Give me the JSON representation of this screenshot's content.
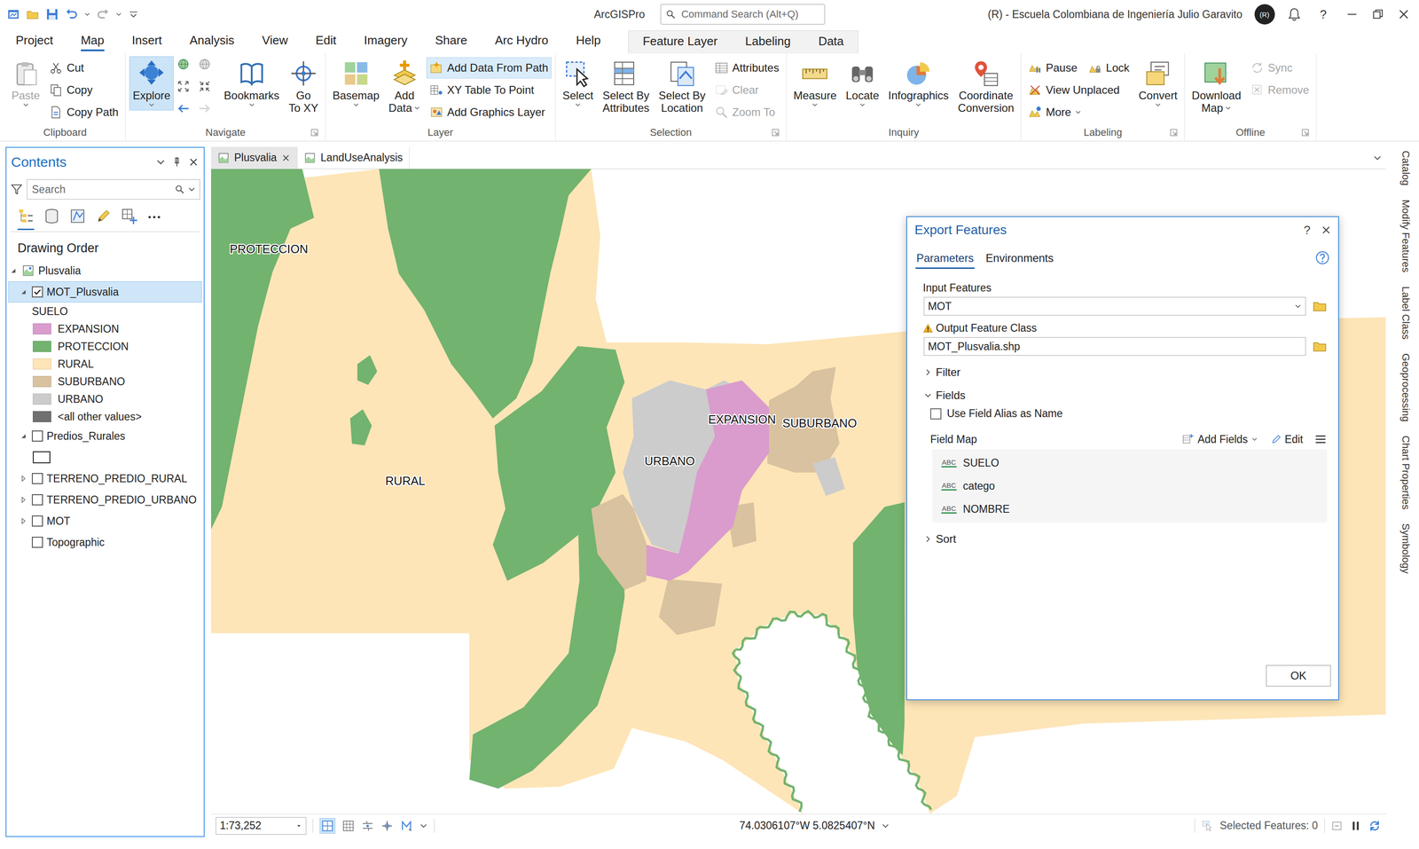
{
  "window": {
    "app_title": "ArcGISPro",
    "command_search": {
      "placeholder": "Command Search (Alt+Q)"
    },
    "account": "(R) - Escuela Colombiana de Ingeniería Julio Garavito",
    "avatar": "(R)",
    "help": "?"
  },
  "ribbon_tabs": [
    {
      "label": "Project",
      "selected": false,
      "contextual": false
    },
    {
      "label": "Map",
      "selected": true,
      "contextual": false
    },
    {
      "label": "Insert",
      "selected": false,
      "contextual": false
    },
    {
      "label": "Analysis",
      "selected": false,
      "contextual": false
    },
    {
      "label": "View",
      "selected": false,
      "contextual": false
    },
    {
      "label": "Edit",
      "selected": false,
      "contextual": false
    },
    {
      "label": "Imagery",
      "selected": false,
      "contextual": false
    },
    {
      "label": "Share",
      "selected": false,
      "contextual": false
    },
    {
      "label": "Arc Hydro",
      "selected": false,
      "contextual": false
    },
    {
      "label": "Help",
      "selected": false,
      "contextual": false
    },
    {
      "label": "Feature Layer",
      "selected": false,
      "contextual": true
    },
    {
      "label": "Labeling",
      "selected": false,
      "contextual": true
    },
    {
      "label": "Data",
      "selected": false,
      "contextual": true
    }
  ],
  "ribbon_groups": [
    {
      "label": "Clipboard",
      "launcher": false,
      "columns": [
        {
          "kind": "large",
          "lines": [
            "Paste"
          ],
          "dropdown": true,
          "disabled": true,
          "highlighted": false
        },
        {
          "kind": "small",
          "rows": [
            [
              {
                "label": "Cut",
                "dropdown": false,
                "disabled": false,
                "highlighted": false
              }
            ],
            [
              {
                "label": "Copy",
                "dropdown": false,
                "disabled": false,
                "highlighted": false
              }
            ],
            [
              {
                "label": "Copy Path",
                "dropdown": false,
                "disabled": false,
                "highlighted": false
              }
            ]
          ]
        }
      ]
    },
    {
      "label": "Navigate",
      "launcher": true,
      "columns": [
        {
          "kind": "large",
          "lines": [
            "Explore"
          ],
          "dropdown": true,
          "disabled": false,
          "highlighted": true
        },
        {
          "kind": "icons",
          "items": [
            {
              "disabled": false
            },
            {
              "disabled": false
            },
            {
              "disabled": false
            },
            {
              "disabled": false
            },
            {
              "disabled": false
            },
            {
              "disabled": true
            }
          ]
        },
        {
          "kind": "large",
          "lines": [
            "Bookmarks"
          ],
          "dropdown": true,
          "disabled": false,
          "highlighted": false
        },
        {
          "kind": "large",
          "lines": [
            "Go",
            "To XY"
          ],
          "dropdown": false,
          "disabled": false,
          "highlighted": false
        }
      ]
    },
    {
      "label": "Layer",
      "launcher": false,
      "columns": [
        {
          "kind": "large",
          "lines": [
            "Basemap"
          ],
          "dropdown": true,
          "disabled": false,
          "highlighted": false
        },
        {
          "kind": "large",
          "lines": [
            "Add",
            "Data"
          ],
          "dropdown": true,
          "disabled": false,
          "highlighted": false
        },
        {
          "kind": "small",
          "rows": [
            [
              {
                "label": "Add Data From Path",
                "dropdown": false,
                "disabled": false,
                "highlighted": true
              }
            ],
            [
              {
                "label": "XY Table To Point",
                "dropdown": false,
                "disabled": false,
                "highlighted": false
              }
            ],
            [
              {
                "label": "Add Graphics Layer",
                "dropdown": false,
                "disabled": false,
                "highlighted": false
              }
            ]
          ]
        }
      ]
    },
    {
      "label": "Selection",
      "launcher": true,
      "columns": [
        {
          "kind": "large",
          "lines": [
            "Select"
          ],
          "dropdown": true,
          "disabled": false,
          "highlighted": false
        },
        {
          "kind": "large",
          "lines": [
            "Select By",
            "Attributes"
          ],
          "dropdown": false,
          "disabled": false,
          "highlighted": false
        },
        {
          "kind": "large",
          "lines": [
            "Select By",
            "Location"
          ],
          "dropdown": false,
          "disabled": false,
          "highlighted": false
        },
        {
          "kind": "small",
          "rows": [
            [
              {
                "label": "Attributes",
                "dropdown": false,
                "disabled": false,
                "highlighted": false
              }
            ],
            [
              {
                "label": "Clear",
                "dropdown": false,
                "disabled": true,
                "highlighted": false
              }
            ],
            [
              {
                "label": "Zoom To",
                "dropdown": false,
                "disabled": true,
                "highlighted": false
              }
            ]
          ]
        }
      ]
    },
    {
      "label": "Inquiry",
      "launcher": false,
      "columns": [
        {
          "kind": "large",
          "lines": [
            "Measure"
          ],
          "dropdown": true,
          "disabled": false,
          "highlighted": false
        },
        {
          "kind": "large",
          "lines": [
            "Locate"
          ],
          "dropdown": true,
          "disabled": false,
          "highlighted": false
        },
        {
          "kind": "large",
          "lines": [
            "Infographics"
          ],
          "dropdown": true,
          "disabled": false,
          "highlighted": false
        },
        {
          "kind": "large",
          "lines": [
            "Coordinate",
            "Conversion"
          ],
          "dropdown": false,
          "disabled": false,
          "highlighted": false
        }
      ]
    },
    {
      "label": "Labeling",
      "launcher": true,
      "columns": [
        {
          "kind": "small",
          "rows": [
            [
              {
                "label": "Pause",
                "dropdown": false,
                "disabled": false,
                "highlighted": false
              },
              {
                "label": "Lock",
                "dropdown": false,
                "disabled": false,
                "highlighted": false
              }
            ],
            [
              {
                "label": "View Unplaced",
                "dropdown": false,
                "disabled": false,
                "highlighted": false
              }
            ],
            [
              {
                "label": "More",
                "dropdown": true,
                "disabled": false,
                "highlighted": false
              }
            ]
          ]
        },
        {
          "kind": "large",
          "lines": [
            "Convert"
          ],
          "dropdown": true,
          "disabled": false,
          "highlighted": false
        }
      ]
    },
    {
      "label": "Offline",
      "launcher": true,
      "columns": [
        {
          "kind": "large",
          "lines": [
            "Download",
            "Map"
          ],
          "dropdown": true,
          "disabled": false,
          "highlighted": false
        },
        {
          "kind": "small",
          "rows": [
            [
              {
                "label": "Sync",
                "dropdown": false,
                "disabled": true,
                "highlighted": false
              }
            ],
            [
              {
                "label": "Remove",
                "dropdown": false,
                "disabled": true,
                "highlighted": false
              }
            ]
          ]
        }
      ]
    }
  ],
  "contents": {
    "title": "Contents",
    "search": {
      "placeholder": "Search"
    },
    "tool_tabs": [
      {
        "selected": true
      },
      {
        "selected": false
      },
      {
        "selected": false
      },
      {
        "selected": false
      },
      {
        "selected": false
      }
    ],
    "heading": "Drawing Order",
    "map": {
      "name": "Plusvalia",
      "expanded": true
    },
    "layers": [
      {
        "name": "MOT_Plusvalia",
        "checked": true,
        "selected": true,
        "expandable": true,
        "expanded": true,
        "field": "SUELO",
        "legend": [
          {
            "label": "EXPANSION",
            "color": "#d99ccd"
          },
          {
            "label": "PROTECCION",
            "color": "#72b36f"
          },
          {
            "label": "RURAL",
            "color": "#fde5b7"
          },
          {
            "label": "SUBURBANO",
            "color": "#d9c29f"
          },
          {
            "label": "URBANO",
            "color": "#cccccc"
          },
          {
            "label": "<all other values>",
            "color": "#707070"
          }
        ]
      },
      {
        "name": "Predios_Rurales",
        "checked": false,
        "selected": false,
        "expandable": true,
        "expanded": true,
        "outline_symbol": true
      },
      {
        "name": "TERRENO_PREDIO_RURAL",
        "checked": false,
        "selected": false,
        "expandable": true,
        "expanded": false
      },
      {
        "name": "TERRENO_PREDIO_URBANO",
        "checked": false,
        "selected": false,
        "expandable": true,
        "expanded": false
      },
      {
        "name": "MOT",
        "checked": false,
        "selected": false,
        "expandable": true,
        "expanded": false
      },
      {
        "name": "Topographic",
        "checked": false,
        "selected": false,
        "expandable": false
      }
    ]
  },
  "map_tabs": [
    {
      "label": "Plusvalia",
      "selected": true,
      "closable": true
    },
    {
      "label": "LandUseAnalysis",
      "selected": false,
      "closable": false
    }
  ],
  "map": {
    "labels": [
      "PROTECCION",
      "RURAL",
      "URBANO",
      "EXPANSION",
      "SUBURBANO"
    ]
  },
  "dialog": {
    "title": "Export Features",
    "help": "?",
    "tabs": [
      {
        "label": "Parameters",
        "selected": true
      },
      {
        "label": "Environments",
        "selected": false
      }
    ],
    "parameters": [
      {
        "label": "Input Features",
        "value": "MOT",
        "warning": false,
        "dropdown": true
      },
      {
        "label": "Output Feature Class",
        "value": "MOT_Plusvalia.shp",
        "warning": true,
        "dropdown": false
      }
    ],
    "sections": [
      {
        "label": "Filter",
        "expanded": false
      },
      {
        "label": "Fields",
        "expanded": true
      },
      {
        "label": "Sort",
        "expanded": false
      }
    ],
    "use_field_alias": {
      "label": "Use Field Alias as Name",
      "checked": false
    },
    "field_map": {
      "label": "Field Map",
      "add_fields": "Add Fields",
      "edit": "Edit",
      "fields": [
        {
          "type": "ABC",
          "name": "SUELO"
        },
        {
          "type": "ABC",
          "name": "catego"
        },
        {
          "type": "ABC",
          "name": "NOMBRE"
        }
      ]
    },
    "ok": "OK"
  },
  "status_bar": {
    "scale": "1:73,252",
    "coordinates": "74.0306107°W 5.0825407°N",
    "selected_features": "Selected Features: 0"
  },
  "dock_tabs": [
    "Catalog",
    "Modify Features",
    "Label Class",
    "Geoprocessing",
    "Chart Properties",
    "Symbology"
  ]
}
